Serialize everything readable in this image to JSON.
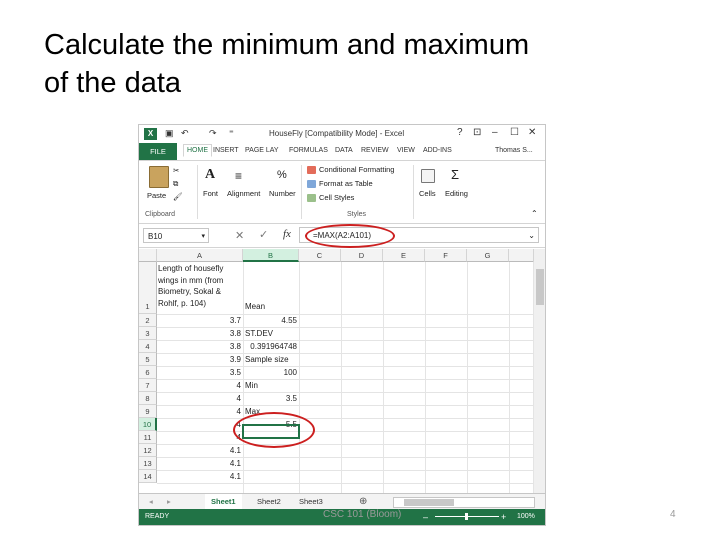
{
  "slide": {
    "title_line1": "Calculate the minimum and maximum",
    "title_line2": "of the data",
    "footer": "CSC 101 (Bloom)",
    "page_number": "4"
  },
  "excel": {
    "window_title": "HouseFly  [Compatibility Mode]  - Excel",
    "window_controls": [
      "?",
      "⊡",
      "–",
      "☐",
      "✕"
    ],
    "file_tab": "FILE",
    "ribbon_tabs": [
      "HOME",
      "INSERT",
      "PAGE LAY",
      "FORMULAS",
      "DATA",
      "REVIEW",
      "VIEW",
      "ADD-INS"
    ],
    "user": "Thomas S...",
    "ribbon": {
      "paste": "Paste",
      "clipboard": "Clipboard",
      "font": "Font",
      "alignment": "Alignment",
      "number": "Number",
      "conditional_formatting": "Conditional Formatting",
      "format_as_table": "Format as Table",
      "cell_styles": "Cell Styles",
      "styles": "Styles",
      "cells": "Cells",
      "editing": "Editing"
    },
    "name_box": "B10",
    "formula_bar": "=MAX(A2:A101)",
    "columns": [
      "A",
      "B",
      "C",
      "D",
      "E",
      "F",
      "G"
    ],
    "rows": [
      "1",
      "2",
      "3",
      "4",
      "5",
      "6",
      "7",
      "8",
      "9",
      "10",
      "11",
      "12",
      "13",
      "14"
    ],
    "a1_text": "Length of housefly wings in mm (from Biometry, Sokal & Rohlf, p. 104)",
    "b1": "Mean",
    "col_a_values": [
      "3.8",
      "3.7",
      "3.8",
      "3.8",
      "3.9",
      "3.5",
      "4",
      "4",
      "4",
      "4",
      "4",
      "4.1",
      "4.1",
      "4.1"
    ],
    "col_b_values": [
      "Mean",
      "4.55",
      "ST.DEV",
      "0.391964748",
      "Sample size",
      "100",
      "Min",
      "3.5",
      "Max",
      "5.5",
      "",
      "",
      "",
      ""
    ],
    "sheet_tabs": [
      "Sheet1",
      "Sheet2",
      "Sheet3"
    ],
    "status": "READY",
    "zoom": "100%"
  },
  "colors": {
    "excel_green": "#217346",
    "highlight_red": "#cc1f1f"
  }
}
